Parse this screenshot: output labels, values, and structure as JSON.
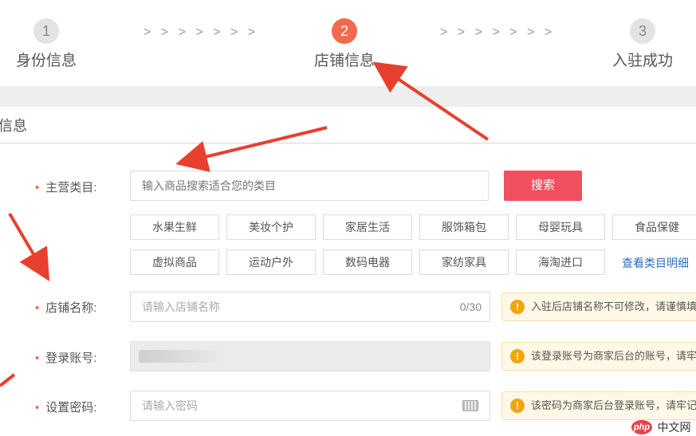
{
  "steps": [
    {
      "number": "1",
      "label": "身份信息"
    },
    {
      "number": "2",
      "label": "店铺信息"
    },
    {
      "number": "3",
      "label": "入驻成功"
    }
  ],
  "step_separator": "> > > > > > >",
  "section_title": "信息",
  "form": {
    "category": {
      "label": "主营类目:",
      "placeholder": "输入商品搜索适合您的类目",
      "search_label": "搜索"
    },
    "categories": [
      "水果生鲜",
      "美妆个护",
      "家居生活",
      "服饰箱包",
      "母婴玩具",
      "食品保健",
      "虚拟商品",
      "运动户外",
      "数码电器",
      "家纺家具",
      "海淘进口"
    ],
    "view_categories_link": "查看类目明细",
    "shop_name": {
      "label": "店铺名称:",
      "placeholder": "请输入店铺名称",
      "counter": "0/30",
      "hint": "入驻后店铺名称不可修改，请谨慎填写"
    },
    "account": {
      "label": "登录账号:",
      "hint": "该登录账号为商家后台的账号，请牢记"
    },
    "password": {
      "label": "设置密码:",
      "placeholder": "请输入密码",
      "hint": "该密码为商家后台登录账号，请牢记"
    }
  },
  "watermark": {
    "logo": "php",
    "text": "中文网"
  },
  "colors": {
    "accent": "#f26a4d",
    "search_button": "#ef4f5f",
    "link": "#2a6ec2",
    "hint_background": "#fff8e6",
    "warn_icon": "#f2a50c",
    "annotation_arrow": "#e8402e"
  }
}
